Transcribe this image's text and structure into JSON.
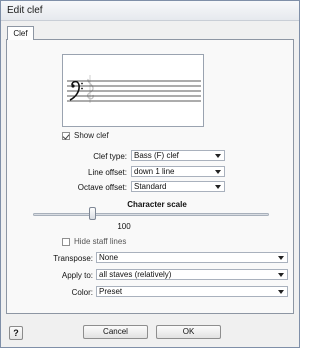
{
  "window": {
    "title": "Edit clef"
  },
  "tabs": [
    {
      "label": "Clef",
      "active": true
    }
  ],
  "preview": {
    "clef_icon": "bass-clef-icon"
  },
  "show_clef": {
    "label": "Show clef",
    "checked": true
  },
  "fields": {
    "clef_type": {
      "label": "Clef type:",
      "value": "Bass (F) clef"
    },
    "line_offset": {
      "label": "Line offset:",
      "value": "down 1 line"
    },
    "octave_offset": {
      "label": "Octave offset:",
      "value": "Standard"
    }
  },
  "character_scale": {
    "title": "Character scale",
    "value": 100,
    "min": 0,
    "max": 400
  },
  "hide_staff_lines": {
    "label": "Hide staff lines",
    "checked": false
  },
  "transpose": {
    "label": "Transpose:",
    "value": "None"
  },
  "apply_to": {
    "label": "Apply to:",
    "value": "all staves (relatively)"
  },
  "color": {
    "label": "Color:",
    "value": "Preset"
  },
  "buttons": {
    "help_label": "?",
    "cancel_label": "Cancel",
    "ok_label": "OK"
  }
}
